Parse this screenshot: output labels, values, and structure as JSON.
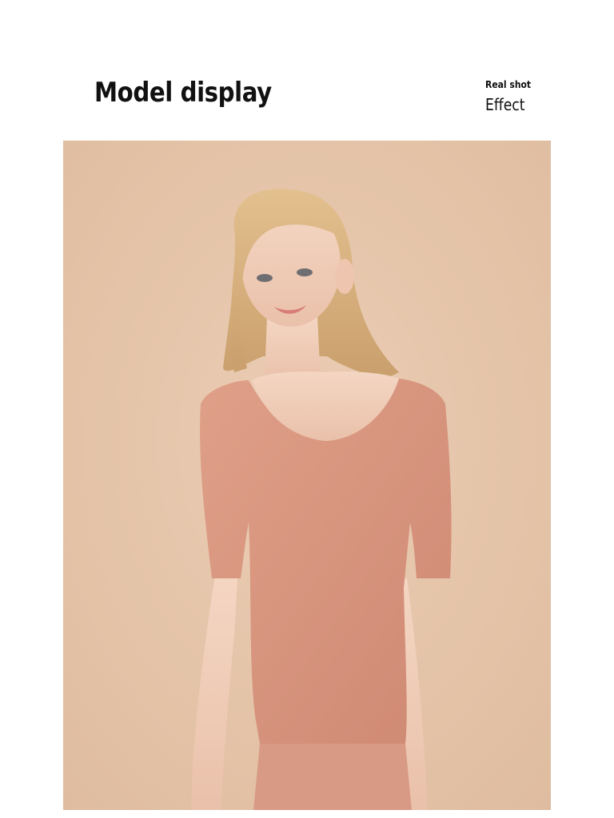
{
  "header": {
    "title": "Model display",
    "tag_small": "Real shot",
    "tag_large": "Effect"
  },
  "photo": {
    "subject": "model-photo",
    "background_color": "#e6c6ac",
    "garment_color": "#d9957f",
    "hair_color": "#d8b584",
    "skin_color": "#f1cdb8"
  }
}
